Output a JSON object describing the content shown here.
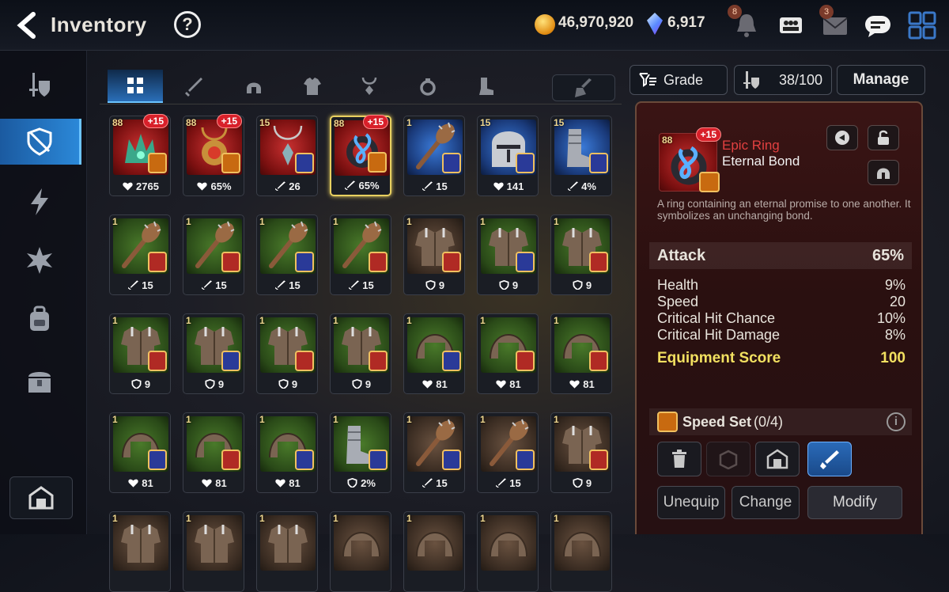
{
  "header": {
    "title": "Inventory",
    "help": "?",
    "gold": "46,970,920",
    "crystals": "6,917",
    "notif_badge": "8",
    "mail_badge": "3"
  },
  "filter": {
    "grade_label": "Grade",
    "capacity": "38/100",
    "manage_label": "Manage"
  },
  "items": [
    {
      "lvl": "88",
      "plus": "+15",
      "bg": "red",
      "set": "org",
      "stat": "2765",
      "stat_icon": "heart",
      "art": "crown"
    },
    {
      "lvl": "88",
      "plus": "+15",
      "bg": "red",
      "set": "org",
      "stat": "65%",
      "stat_icon": "heart",
      "art": "amulet"
    },
    {
      "lvl": "15",
      "plus": "",
      "bg": "red",
      "set": "blue",
      "stat": "26",
      "stat_icon": "sword",
      "art": "necklace"
    },
    {
      "lvl": "88",
      "plus": "+15",
      "bg": "red",
      "set": "org",
      "stat": "65%",
      "stat_icon": "sword",
      "art": "ring",
      "selected": true
    },
    {
      "lvl": "1",
      "plus": "",
      "bg": "blue",
      "set": "blue",
      "stat": "15",
      "stat_icon": "sword",
      "art": "club"
    },
    {
      "lvl": "15",
      "plus": "",
      "bg": "blue",
      "set": "blue",
      "stat": "141",
      "stat_icon": "heart",
      "art": "helm"
    },
    {
      "lvl": "15",
      "plus": "",
      "bg": "blue",
      "set": "blue",
      "stat": "4%",
      "stat_icon": "sword",
      "art": "boots"
    },
    {
      "lvl": "1",
      "plus": "",
      "bg": "green",
      "set": "red",
      "stat": "15",
      "stat_icon": "sword",
      "art": "club"
    },
    {
      "lvl": "1",
      "plus": "",
      "bg": "green",
      "set": "red",
      "stat": "15",
      "stat_icon": "sword",
      "art": "club"
    },
    {
      "lvl": "1",
      "plus": "",
      "bg": "green",
      "set": "blue",
      "stat": "15",
      "stat_icon": "sword",
      "art": "club"
    },
    {
      "lvl": "1",
      "plus": "",
      "bg": "green",
      "set": "red",
      "stat": "15",
      "stat_icon": "sword",
      "art": "club"
    },
    {
      "lvl": "1",
      "plus": "",
      "bg": "brown",
      "set": "red",
      "stat": "9",
      "stat_icon": "shield",
      "art": "armor"
    },
    {
      "lvl": "1",
      "plus": "",
      "bg": "green",
      "set": "blue",
      "stat": "9",
      "stat_icon": "shield",
      "art": "armor"
    },
    {
      "lvl": "1",
      "plus": "",
      "bg": "green",
      "set": "red",
      "stat": "9",
      "stat_icon": "shield",
      "art": "armor"
    },
    {
      "lvl": "1",
      "plus": "",
      "bg": "green",
      "set": "red",
      "stat": "9",
      "stat_icon": "shield",
      "art": "armor"
    },
    {
      "lvl": "1",
      "plus": "",
      "bg": "green",
      "set": "blue",
      "stat": "9",
      "stat_icon": "shield",
      "art": "armor"
    },
    {
      "lvl": "1",
      "plus": "",
      "bg": "green",
      "set": "red",
      "stat": "9",
      "stat_icon": "shield",
      "art": "armor"
    },
    {
      "lvl": "1",
      "plus": "",
      "bg": "green",
      "set": "red",
      "stat": "9",
      "stat_icon": "shield",
      "art": "armor"
    },
    {
      "lvl": "1",
      "plus": "",
      "bg": "green",
      "set": "blue",
      "stat": "81",
      "stat_icon": "heart",
      "art": "helmet"
    },
    {
      "lvl": "1",
      "plus": "",
      "bg": "green",
      "set": "red",
      "stat": "81",
      "stat_icon": "heart",
      "art": "helmet"
    },
    {
      "lvl": "1",
      "plus": "",
      "bg": "green",
      "set": "red",
      "stat": "81",
      "stat_icon": "heart",
      "art": "helmet"
    },
    {
      "lvl": "1",
      "plus": "",
      "bg": "green",
      "set": "blue",
      "stat": "81",
      "stat_icon": "heart",
      "art": "helmet"
    },
    {
      "lvl": "1",
      "plus": "",
      "bg": "green",
      "set": "red",
      "stat": "81",
      "stat_icon": "heart",
      "art": "helmet"
    },
    {
      "lvl": "1",
      "plus": "",
      "bg": "green",
      "set": "blue",
      "stat": "81",
      "stat_icon": "heart",
      "art": "helmet"
    },
    {
      "lvl": "1",
      "plus": "",
      "bg": "green",
      "set": "blue",
      "stat": "2%",
      "stat_icon": "shield",
      "art": "boots"
    },
    {
      "lvl": "1",
      "plus": "",
      "bg": "brown",
      "set": "blue",
      "stat": "15",
      "stat_icon": "sword",
      "art": "club"
    },
    {
      "lvl": "1",
      "plus": "",
      "bg": "brown",
      "set": "blue",
      "stat": "15",
      "stat_icon": "sword",
      "art": "club"
    },
    {
      "lvl": "1",
      "plus": "",
      "bg": "brown",
      "set": "red",
      "stat": "9",
      "stat_icon": "shield",
      "art": "armor"
    },
    {
      "lvl": "1",
      "plus": "",
      "bg": "brown",
      "set": "",
      "stat": "",
      "stat_icon": "",
      "art": "armor"
    },
    {
      "lvl": "1",
      "plus": "",
      "bg": "brown",
      "set": "",
      "stat": "",
      "stat_icon": "",
      "art": "armor"
    },
    {
      "lvl": "1",
      "plus": "",
      "bg": "brown",
      "set": "",
      "stat": "",
      "stat_icon": "",
      "art": "armor"
    },
    {
      "lvl": "1",
      "plus": "",
      "bg": "brown",
      "set": "",
      "stat": "",
      "stat_icon": "",
      "art": "helmet"
    },
    {
      "lvl": "1",
      "plus": "",
      "bg": "brown",
      "set": "",
      "stat": "",
      "stat_icon": "",
      "art": "helmet"
    },
    {
      "lvl": "1",
      "plus": "",
      "bg": "brown",
      "set": "",
      "stat": "",
      "stat_icon": "",
      "art": "helmet"
    },
    {
      "lvl": "1",
      "plus": "",
      "bg": "brown",
      "set": "",
      "stat": "",
      "stat_icon": "",
      "art": "helmet"
    }
  ],
  "detail": {
    "level": "88",
    "plus": "+15",
    "grade": "Epic Ring",
    "name": "Eternal Bond",
    "description": "A ring containing an eternal promise to one another. It symbolizes an unchanging bond.",
    "main_stat": {
      "label": "Attack",
      "value": "65%"
    },
    "sub_stats": [
      {
        "label": "Health",
        "value": "9%"
      },
      {
        "label": "Speed",
        "value": "20"
      },
      {
        "label": "Critical Hit Chance",
        "value": "10%"
      },
      {
        "label": "Critical Hit Damage",
        "value": "8%"
      }
    ],
    "score": {
      "label": "Equipment Score",
      "value": "100"
    },
    "set_name": "Speed Set",
    "set_progress": "(0/4)",
    "unequip_label": "Unequip",
    "change_label": "Change",
    "modify_label": "Modify"
  }
}
